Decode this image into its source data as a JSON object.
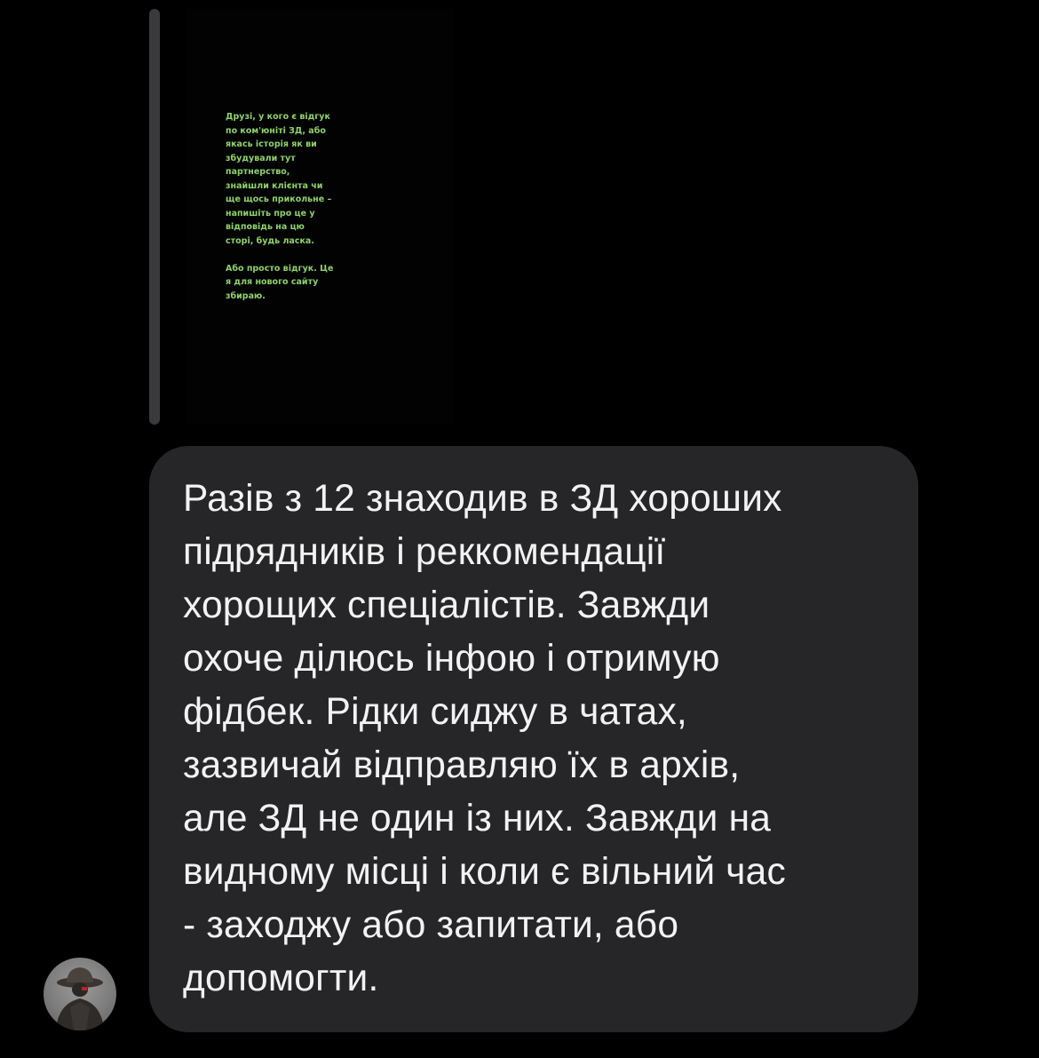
{
  "story_reply": {
    "story_text": "Друзі, у кого є відгук\nпо ком'юніті ЗД, або\nякась історія як ви\nзбудували тут\nпартнерство,\nзнайшли клієнта чи\nще щось прикольне –\nнапишіть про це у\nвідповідь на цю\nсторі, будь ласка.\n\nАбо просто відгук. Це\nя для нового сайту\nзбираю.",
    "text_color": "#8fd16a"
  },
  "message": {
    "text": "Разів з 12 знаходив в ЗД хороших\nпідрядників і реккомендації\nхорощих спеціалістів. Завжди\nохоче ділюсь інфою і отримую\nфідбек. Рідки сиджу в чатах,\nзазвичай відправляю їх в архів,\nале ЗД не один із них. Завжди на\nвидному місці і коли є вільний час\n- заходжу або запитати, або\nдопомогти.",
    "bubble_color": "#262628",
    "text_color": "#f2f2f2"
  },
  "sender": {
    "avatar_icon": "person-in-hat-avatar"
  }
}
